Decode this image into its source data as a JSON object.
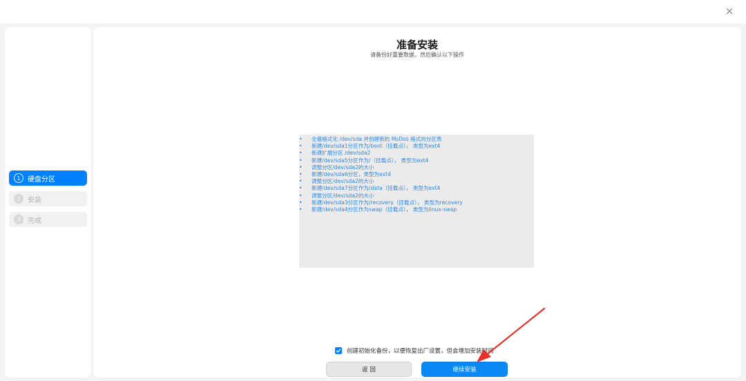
{
  "window": {
    "close_glyph": "×"
  },
  "sidebar": {
    "steps": [
      {
        "num": "1",
        "label": "硬盘分区",
        "state": "active"
      },
      {
        "num": "2",
        "label": "安装",
        "state": "inactive"
      },
      {
        "num": "3",
        "label": "完成",
        "state": "inactive"
      }
    ]
  },
  "main": {
    "title": "准备安装",
    "subtitle": "请备份好重要数据，然后确认以下操作",
    "operations": [
      "全盘格式化 /dev/sda 并创建新的 MsDos 格式的分区表",
      "新建/dev/sda1分区作为/boot（挂载点）， 类型为ext4",
      "新建扩展分区 /dev/sda2",
      "新建/dev/sda5分区作为/（挂载点）， 类型为ext4",
      "调整分区/dev/sda2的大小",
      "新建/dev/sda6分区，类型为ext4",
      "调整分区/dev/sda2的大小",
      "新建/dev/sda7分区作为/data（挂载点）， 类型为ext4",
      "调整分区/dev/sda2的大小",
      "新建/dev/sda3分区作为/recovery（挂载点）， 类型为recovery",
      "新建/dev/sda4分区作为swap（挂载点）， 类型为linux-swap"
    ],
    "backup_checkbox": {
      "checked": true,
      "label": "创建初始化备份，以便恢复出厂设置，但会增加安装时间"
    },
    "buttons": {
      "back": "返 回",
      "continue": "继续安装"
    }
  },
  "annotation": {
    "arrow_color": "#e8302a"
  },
  "colors": {
    "accent": "#0081ff",
    "operation_text": "#2f86e8"
  }
}
